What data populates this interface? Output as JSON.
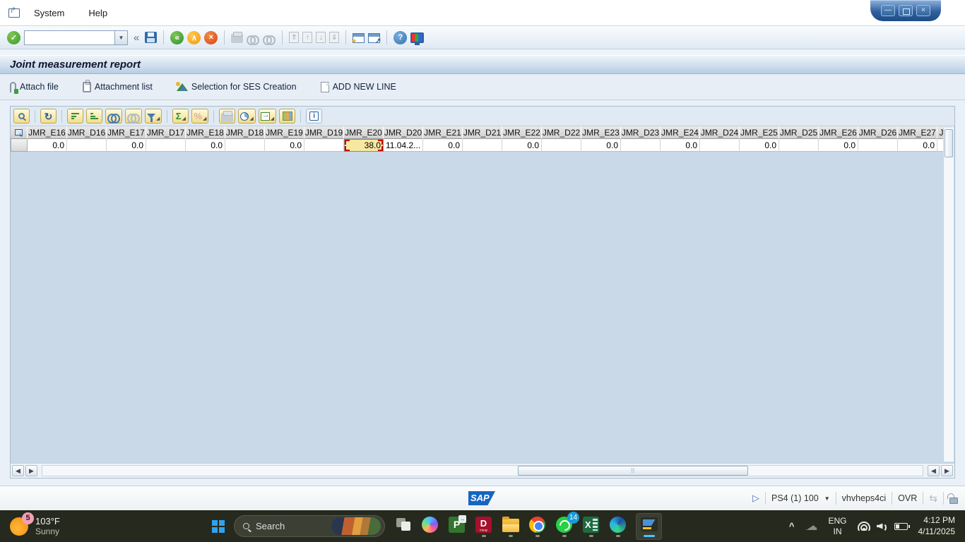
{
  "window": {
    "menus": [
      {
        "label": "System"
      },
      {
        "label": "Help"
      }
    ],
    "controls": {
      "minimize": "—",
      "close": "×"
    },
    "title": "Joint measurement report"
  },
  "toolbar": {
    "command_value": "",
    "collapse_glyph": "«",
    "enter_glyph": "✓",
    "back_glyph": "«",
    "exit_glyph": "∧",
    "cancel_glyph": "×",
    "help_glyph": "?",
    "icons": [
      "enter-icon",
      "command-field",
      "save-icon",
      "back-icon",
      "exit-icon",
      "cancel-icon",
      "print-icon",
      "find-icon",
      "find-next-icon",
      "first-page-icon",
      "page-up-icon",
      "page-down-icon",
      "last-page-icon",
      "new-session-icon",
      "create-shortcut-icon",
      "help-icon",
      "customize-layout-icon"
    ]
  },
  "app_toolbar": {
    "buttons": [
      {
        "label": "Attach file"
      },
      {
        "label": "Attachment list"
      },
      {
        "label": "Selection for SES Creation"
      },
      {
        "label": "ADD NEW LINE"
      }
    ]
  },
  "alv_toolbar": {
    "icons": [
      "details-icon",
      "refresh-icon",
      "sort-ascending-icon",
      "sort-descending-icon",
      "find-icon",
      "find-next-icon",
      "filter-icon",
      "total-icon",
      "subtotal-icon",
      "print-icon",
      "views-icon",
      "export-icon",
      "choose-layout-icon",
      "info-icon"
    ]
  },
  "grid": {
    "columns": [
      "JMR_E16",
      "JMR_D16",
      "JMR_E17",
      "JMR_D17",
      "JMR_E18",
      "JMR_D18",
      "JMR_E19",
      "JMR_D19",
      "JMR_E20",
      "JMR_D20",
      "JMR_E21",
      "JMR_D21",
      "JMR_E22",
      "JMR_D22",
      "JMR_E23",
      "JMR_D23",
      "JMR_E24",
      "JMR_D24",
      "JMR_E25",
      "JMR_D25",
      "JMR_E26",
      "JMR_D26",
      "JMR_E27",
      "J..."
    ],
    "rows": [
      {
        "cells": [
          {
            "v": "0.0",
            "a": "r"
          },
          {
            "v": "",
            "a": "r"
          },
          {
            "v": "0.0",
            "a": "r"
          },
          {
            "v": "",
            "a": "r"
          },
          {
            "v": "0.0",
            "a": "r"
          },
          {
            "v": "",
            "a": "r"
          },
          {
            "v": "0.0",
            "a": "r"
          },
          {
            "v": "",
            "a": "r"
          },
          {
            "v": "38.0",
            "a": "r",
            "sel": true
          },
          {
            "v": "11.04.2...",
            "a": "l"
          },
          {
            "v": "0.0",
            "a": "r"
          },
          {
            "v": "",
            "a": "r"
          },
          {
            "v": "0.0",
            "a": "r"
          },
          {
            "v": "",
            "a": "r"
          },
          {
            "v": "0.0",
            "a": "r"
          },
          {
            "v": "",
            "a": "r"
          },
          {
            "v": "0.0",
            "a": "r"
          },
          {
            "v": "",
            "a": "r"
          },
          {
            "v": "0.0",
            "a": "r"
          },
          {
            "v": "",
            "a": "r"
          },
          {
            "v": "0.0",
            "a": "r"
          },
          {
            "v": "",
            "a": "r"
          },
          {
            "v": "0.0",
            "a": "r"
          },
          {
            "v": "",
            "a": "l"
          }
        ]
      }
    ],
    "selected_cell": {
      "column": "JMR_E20",
      "value": "38.0",
      "highlight_color": "#f6e8a0"
    }
  },
  "statusbar": {
    "sap_logo": "SAP",
    "system": "PS4 (1) 100",
    "server": "vhvheps4ci",
    "mode": "OVR",
    "play_glyph": "▷",
    "dropdown_glyph": "▼",
    "swap_glyph": "⇆"
  },
  "taskbar": {
    "weather": {
      "badge": "5",
      "temp": "103°F",
      "desc": "Sunny"
    },
    "search": {
      "label": "Search"
    },
    "apps": [
      "task-view",
      "copilot",
      "ms-project",
      "autodesk-d-trw",
      "file-explorer",
      "chrome",
      "whatsapp",
      "excel",
      "edge",
      "sap-logon"
    ],
    "whatsapp_badge": "14",
    "dtrw_letter": "D",
    "project_letter": "P",
    "tray": {
      "chevron": "^",
      "lang_line1": "ENG",
      "lang_line2": "IN",
      "time": "4:12 PM",
      "date": "4/11/2025"
    }
  },
  "colors": {
    "sap_brand_blue": "#1565c0",
    "titlebar_gradient_bottom": "#b7cee3",
    "selected_cell_bg": "#f6e8a0",
    "selection_mark_red": "#cc0000",
    "alv_button_face": "#f2dd8d",
    "taskbar_bg": "#262a1e"
  }
}
